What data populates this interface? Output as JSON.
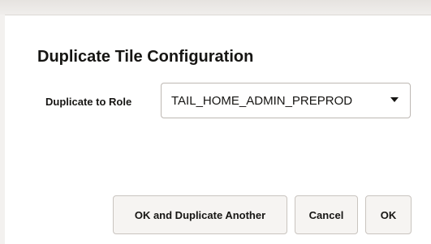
{
  "dialog": {
    "title": "Duplicate Tile Configuration",
    "role_field": {
      "label": "Duplicate to Role",
      "value": "TAIL_HOME_ADMIN_PREPROD"
    },
    "buttons": {
      "ok_and_duplicate": "OK and Duplicate Another",
      "cancel": "Cancel",
      "ok": "OK"
    }
  },
  "icons": {
    "dropdown": "caret-down-icon"
  },
  "colors": {
    "text": "#161513",
    "button_bg": "#f6f4f2",
    "border": "#bdb8b3"
  }
}
